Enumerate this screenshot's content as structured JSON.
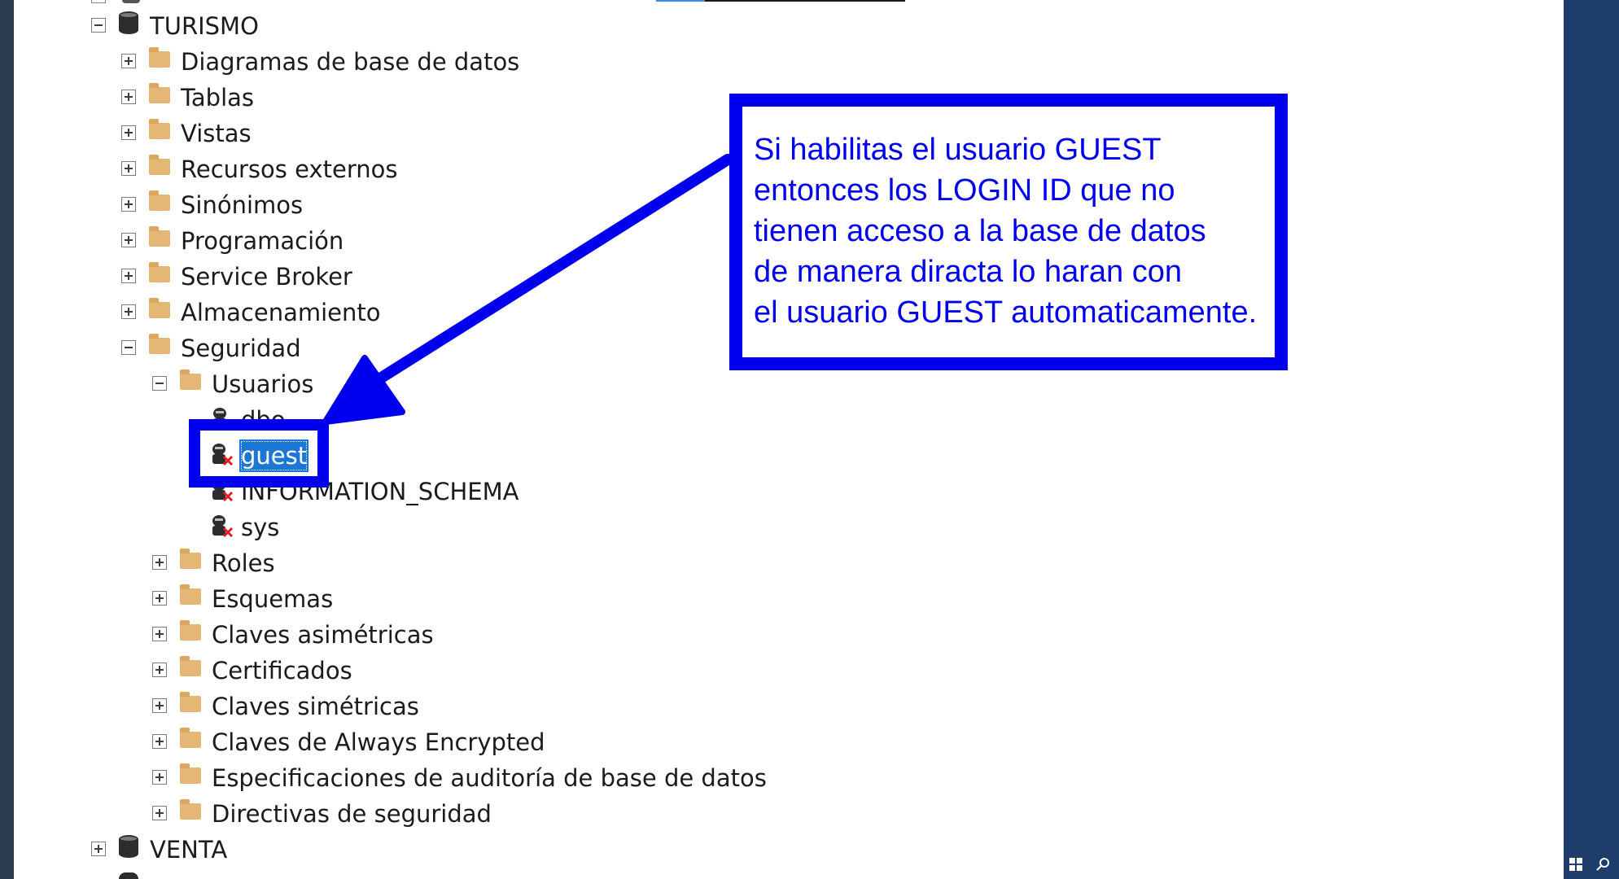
{
  "colors": {
    "annotation": "#0000ee",
    "selection": "#1c76d6",
    "folder": "#e5b774",
    "left_strip": "#2b3a4e",
    "right_panel": "#1e3d6b"
  },
  "tree": {
    "db_turismo": "TURISMO",
    "diagramas": "Diagramas de base de datos",
    "tablas": "Tablas",
    "vistas": "Vistas",
    "recursos": "Recursos externos",
    "sinonimos": "Sinónimos",
    "programacion": "Programación",
    "service_broker": "Service Broker",
    "almacenamiento": "Almacenamiento",
    "seguridad": "Seguridad",
    "usuarios": "Usuarios",
    "dbo": "dbo",
    "guest": "guest",
    "information_schema": "INFORMATION_SCHEMA",
    "sys": "sys",
    "roles": "Roles",
    "esquemas": "Esquemas",
    "claves_asim": "Claves asimétricas",
    "certificados": "Certificados",
    "claves_sim": "Claves simétricas",
    "claves_always": "Claves de Always Encrypted",
    "especificaciones": "Especificaciones de auditoría de base de datos",
    "directivas": "Directivas de seguridad",
    "db_venta": "VENTA"
  },
  "annotation": {
    "text": "Si habilitas el usuario GUEST\nentonces los LOGIN ID que no\ntienen acceso a la base de datos\nde manera diracta lo haran con\nel usuario GUEST automaticamente."
  },
  "icons": {
    "database": "database-icon",
    "folder": "folder-icon",
    "user_disabled": "user-disabled-icon",
    "user": "user-icon",
    "windows": "windows-icon",
    "search": "search-icon"
  }
}
